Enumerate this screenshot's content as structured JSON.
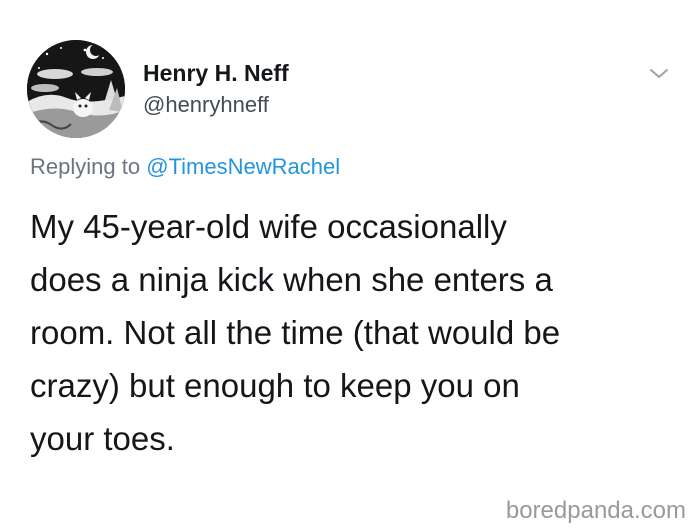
{
  "user": {
    "display_name": "Henry H. Neff",
    "handle": "@henryhneff",
    "avatar_icon": "avatar-illustration"
  },
  "reply": {
    "prefix": "Replying to ",
    "mention": "@TimesNewRachel"
  },
  "tweet": {
    "lines": [
      "My 45-year-old wife occasionally",
      "does a ninja kick when she enters a",
      "room. Not all the time (that would be",
      "crazy) but enough to keep you on",
      "your toes."
    ]
  },
  "menu": {
    "icon": "chevron-down-icon"
  },
  "watermark": {
    "text": "boredpanda.com"
  },
  "colors": {
    "text": "#14171a",
    "secondary": "#6b7580",
    "link": "#2494de",
    "watermark": "#9a9a9a"
  }
}
